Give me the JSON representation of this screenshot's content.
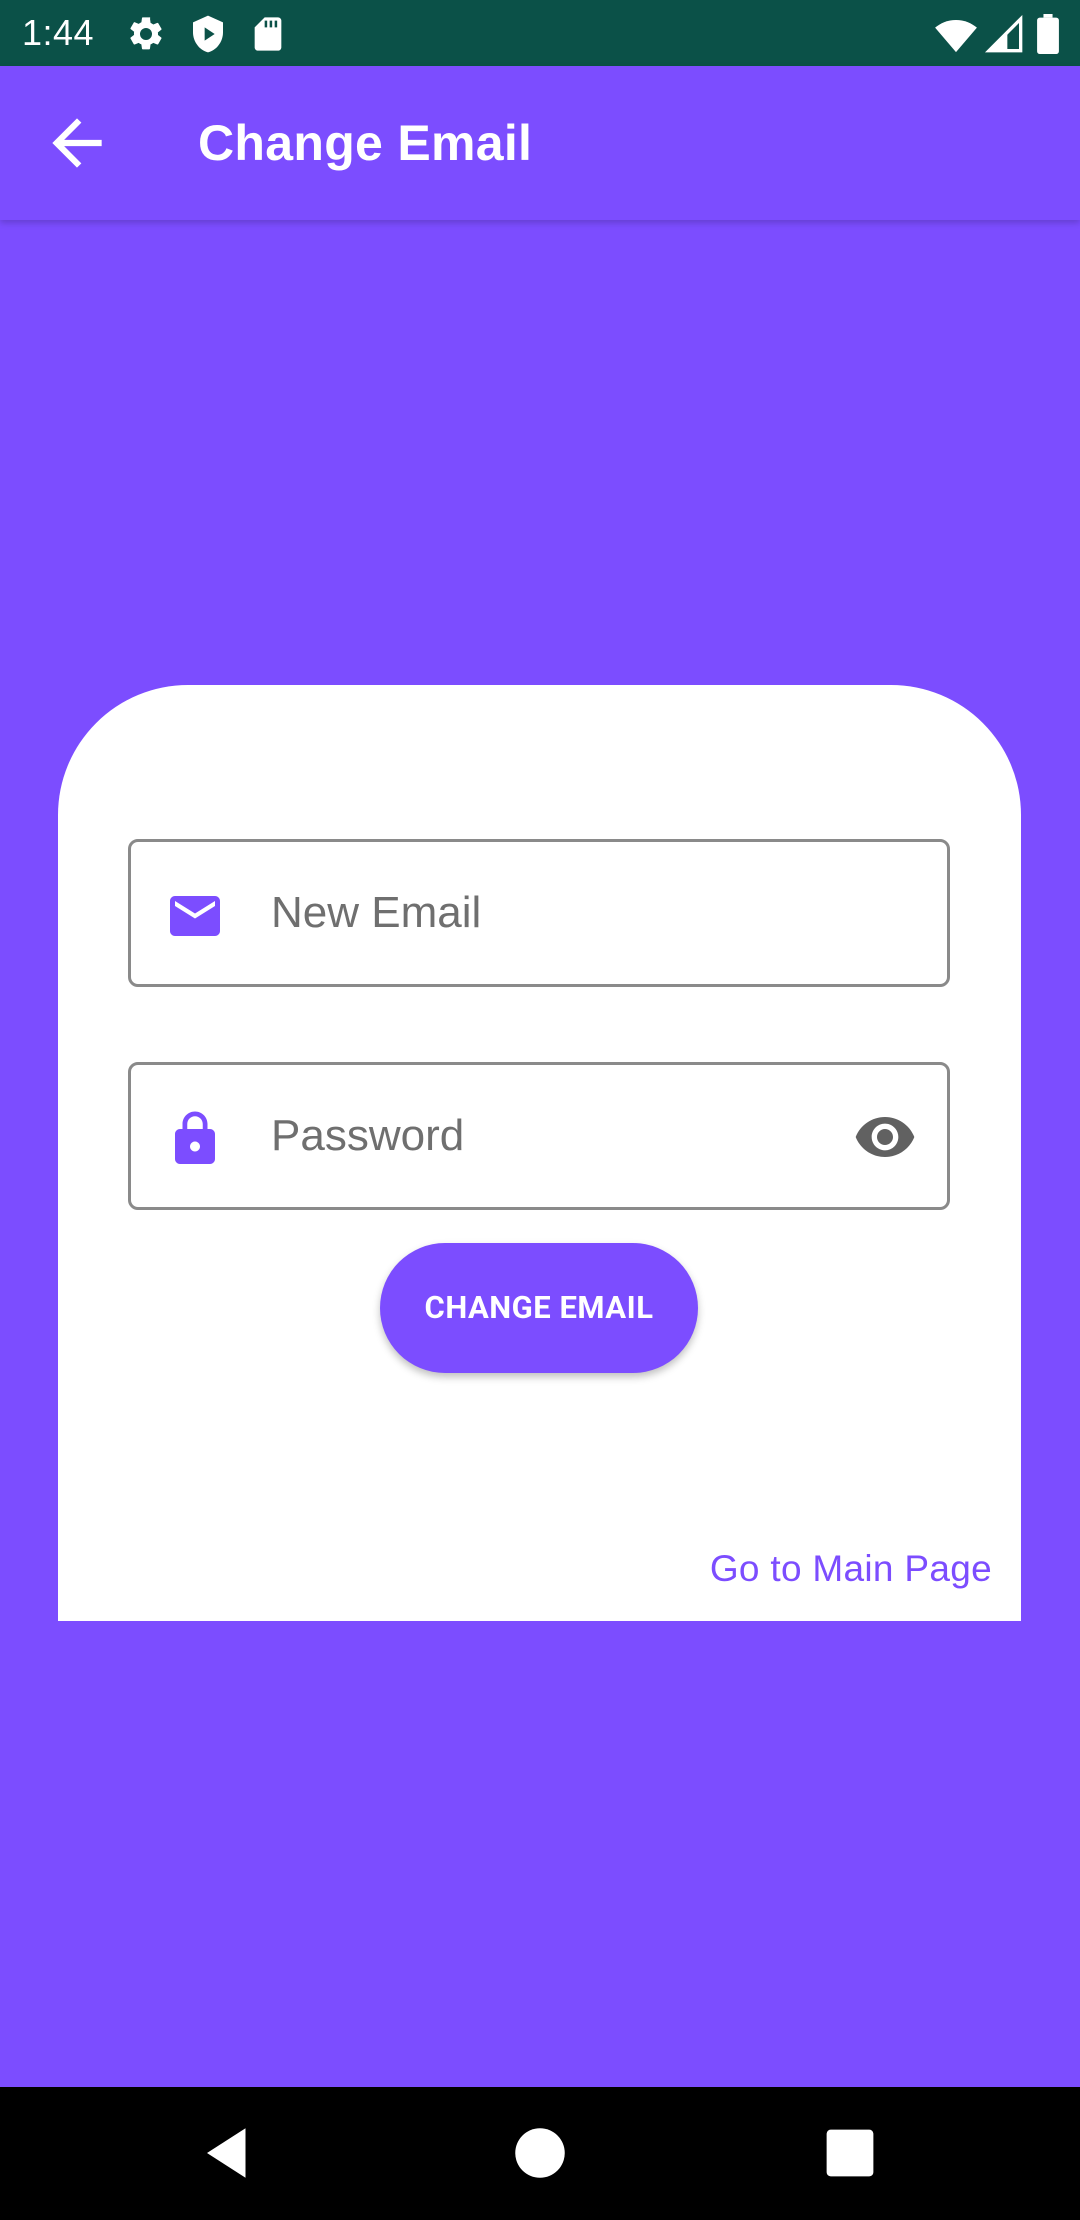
{
  "status_bar": {
    "time": "1:44",
    "left_icons": [
      "gear-icon",
      "shield-play-icon",
      "sd-card-icon"
    ],
    "right_icons": [
      "wifi-icon",
      "signal-icon",
      "battery-icon"
    ]
  },
  "app_bar": {
    "title": "Change Email",
    "back_icon": "arrow-back-icon"
  },
  "form": {
    "email": {
      "placeholder": "New Email",
      "value": "",
      "icon": "mail-icon"
    },
    "password": {
      "placeholder": "Password",
      "value": "",
      "icon": "lock-icon",
      "toggle_icon": "eye-icon"
    },
    "submit_label": "CHANGE EMAIL",
    "main_page_link": "Go to Main Page"
  },
  "nav_bar": {
    "icons": [
      "back-triangle-icon",
      "home-circle-icon",
      "recents-square-icon"
    ]
  },
  "colors": {
    "primary": "#7C4DFF",
    "status_bar": "#0B5148",
    "card": "#FFFFFF",
    "field_border": "#8A8A8A",
    "placeholder": "#6F6F6F"
  }
}
